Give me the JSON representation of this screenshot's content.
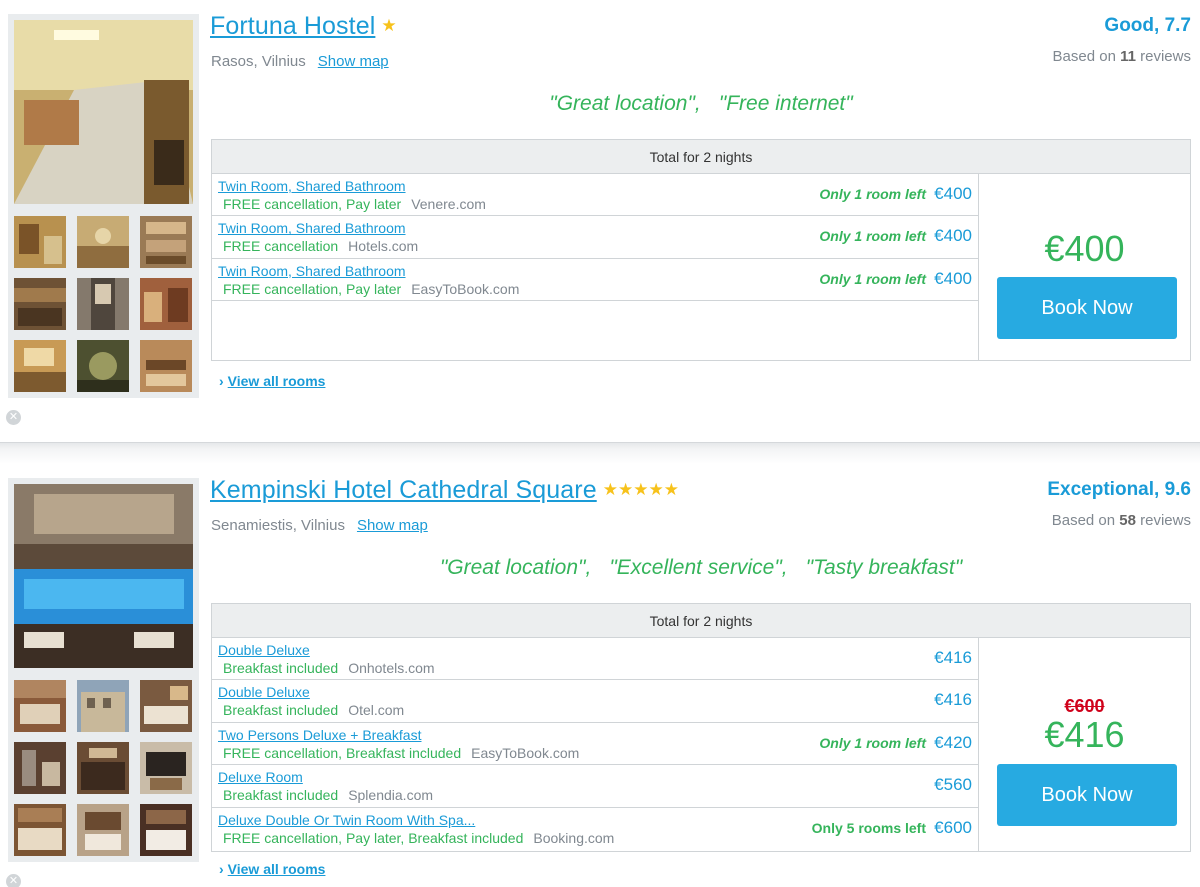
{
  "hotels": [
    {
      "name": "Fortuna Hostel",
      "stars": "★",
      "location": "Rasos, Vilnius",
      "show_map": "Show map",
      "rating": "Good, 7.7",
      "reviews_prefix": "Based on",
      "reviews_count": "11",
      "reviews_suffix": "reviews",
      "quotes": [
        "\"Great location\",",
        "\"Free internet\""
      ],
      "table_header": "Total for 2 nights",
      "offers": [
        {
          "room": "Twin Room, Shared Bathroom",
          "terms": "FREE cancellation, Pay later",
          "site": "Venere.com",
          "availability": "Only 1 room left",
          "price": "€400"
        },
        {
          "room": "Twin Room, Shared Bathroom",
          "terms": "FREE cancellation",
          "site": "Hotels.com",
          "availability": "Only 1 room left",
          "price": "€400"
        },
        {
          "room": "Twin Room, Shared Bathroom",
          "terms": "FREE cancellation, Pay later",
          "site": "EasyToBook.com",
          "availability": "Only 1 room left",
          "price": "€400"
        }
      ],
      "best_price": "€400",
      "book_label": "Book Now",
      "view_all": "View all rooms"
    },
    {
      "name": "Kempinski Hotel Cathedral Square",
      "stars": "★★★★★",
      "location": "Senamiestis, Vilnius",
      "show_map": "Show map",
      "rating": "Exceptional, 9.6",
      "reviews_prefix": "Based on",
      "reviews_count": "58",
      "reviews_suffix": "reviews",
      "quotes": [
        "\"Great location\",",
        "\"Excellent service\",",
        "\"Tasty breakfast\""
      ],
      "table_header": "Total for 2 nights",
      "offers": [
        {
          "room": "Double Deluxe",
          "terms": "Breakfast included",
          "site": "Onhotels.com",
          "availability": "",
          "price": "€416"
        },
        {
          "room": "Double Deluxe",
          "terms": "Breakfast included",
          "site": "Otel.com",
          "availability": "",
          "price": "€416"
        },
        {
          "room": "Two Persons Deluxe + Breakfast",
          "terms": "FREE cancellation, Breakfast included",
          "site": "EasyToBook.com",
          "availability": "Only 1 room left",
          "price": "€420"
        },
        {
          "room": "Deluxe Room",
          "terms": "Breakfast included",
          "site": "Splendia.com",
          "availability": "",
          "price": "€560"
        },
        {
          "room": "Deluxe Double Or Twin Room With Spa...",
          "terms": "FREE cancellation, Pay later, Breakfast included",
          "site": "Booking.com",
          "availability": "Only 5 rooms left",
          "price": "€600"
        }
      ],
      "old_price": "€600",
      "best_price": "€416",
      "book_label": "Book Now",
      "view_all": "View all rooms"
    }
  ],
  "icons": {
    "close": "close-icon",
    "chevron": "›"
  },
  "colors": {
    "accent": "#1a9bd7",
    "green": "#35b45b",
    "button": "#27aae1",
    "strike": "#d0021b"
  }
}
